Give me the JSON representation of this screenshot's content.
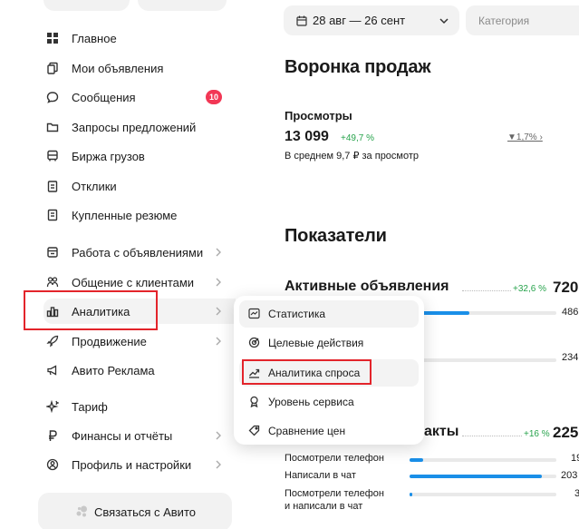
{
  "sidebar": {
    "items": [
      {
        "label": "Главное",
        "icon": "grid-icon"
      },
      {
        "label": "Мои объявления",
        "icon": "copy-icon"
      },
      {
        "label": "Сообщения",
        "icon": "chat-icon",
        "badge": "10"
      },
      {
        "label": "Запросы предложений",
        "icon": "folder-icon"
      },
      {
        "label": "Биржа грузов",
        "icon": "truck-icon"
      },
      {
        "label": "Отклики",
        "icon": "clipboard-icon"
      },
      {
        "label": "Купленные резюме",
        "icon": "document-icon"
      },
      {
        "label": "Работа с объявлениями",
        "icon": "listing-icon"
      },
      {
        "label": "Общение с клиентами",
        "icon": "people-icon"
      },
      {
        "label": "Аналитика",
        "icon": "chart-icon"
      },
      {
        "label": "Продвижение",
        "icon": "rocket-icon"
      },
      {
        "label": "Авито Реклама",
        "icon": "megaphone-icon"
      },
      {
        "label": "Тариф",
        "icon": "sparkle-icon"
      },
      {
        "label": "Финансы и отчёты",
        "icon": "ruble-icon"
      },
      {
        "label": "Профиль и настройки",
        "icon": "profile-icon"
      }
    ],
    "contact_label": "Связаться с Авито"
  },
  "filters": {
    "date_range": "28 авг — 26 сент",
    "category_placeholder": "Категория"
  },
  "funnel": {
    "title": "Воронка продаж",
    "views_label": "Просмотры",
    "views_value": "13 099",
    "views_change": "+49,7 %",
    "views_sub": "В среднем 9,7 ₽ за просмотр",
    "conversion": "▼1,7% ›"
  },
  "indicators": {
    "title": "Показатели",
    "active_label": "Активные объявления",
    "active_change": "+32,6 %",
    "active_value": "720",
    "active_row1_value": "486",
    "active_row1_fill": 0.68,
    "active_row2_value": "234",
    "active_row2_fill": 0.33,
    "contacts_partial": "акты",
    "contacts_change": "+16 %",
    "contacts_value": "225",
    "rows": [
      {
        "label": "Посмотрели телефон",
        "value": "19",
        "fill": 0.09
      },
      {
        "label": "Написали в чат",
        "value": "203",
        "fill": 0.9
      },
      {
        "label": "Посмотрели телефон",
        "label2": "и написали в чат",
        "value": "3",
        "fill": 0.02
      }
    ]
  },
  "analytics_menu": {
    "items": [
      {
        "label": "Статистика",
        "icon": "stats-icon"
      },
      {
        "label": "Целевые действия",
        "icon": "target-icon"
      },
      {
        "label": "Аналитика спроса",
        "icon": "trend-icon"
      },
      {
        "label": "Уровень сервиса",
        "icon": "medal-icon"
      },
      {
        "label": "Сравнение цен",
        "icon": "tag-icon"
      }
    ]
  }
}
